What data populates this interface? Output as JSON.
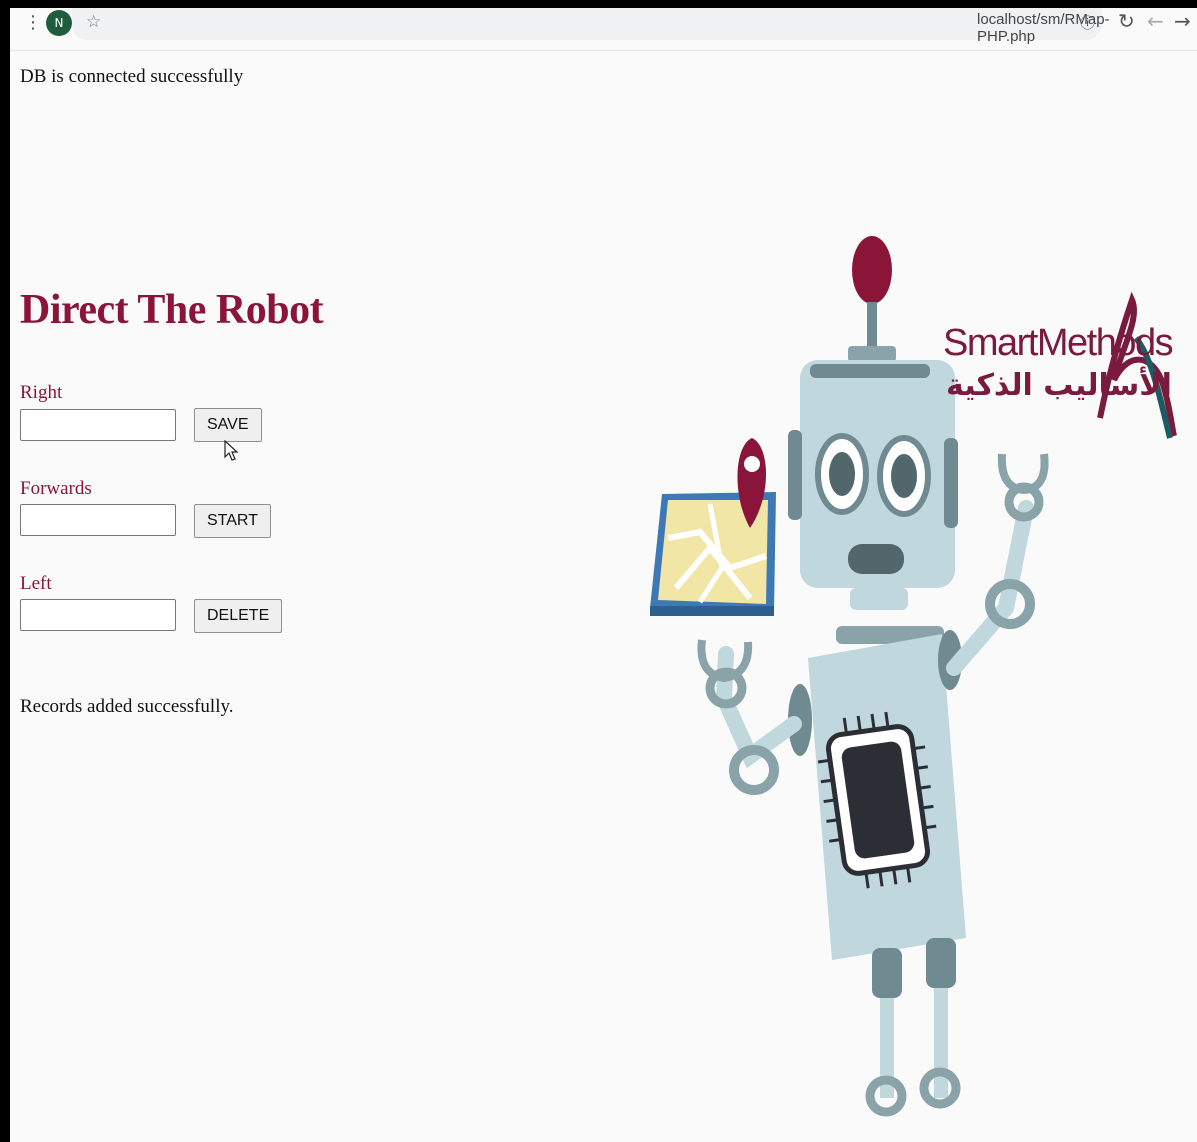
{
  "browser": {
    "url": "localhost/sm/RMap-PHP.php",
    "profile_initial": "N",
    "icons": [
      "menu-dots-icon",
      "star-icon",
      "info-icon",
      "reload-icon",
      "back-icon",
      "forward-icon"
    ]
  },
  "status": {
    "db": "DB is connected successfully",
    "records": "Records added successfully."
  },
  "page": {
    "title": "Direct The Robot"
  },
  "form": {
    "right_label": "Right",
    "right_value": "",
    "forwards_label": "Forwards",
    "forwards_value": "",
    "left_label": "Left",
    "left_value": "",
    "save_label": "SAVE",
    "start_label": "START",
    "delete_label": "DELETE"
  },
  "logo": {
    "english": "SmartMethods",
    "arabic": "الأساليب الذكية"
  },
  "colors": {
    "title": "#8a1538",
    "logo": "#7a1a3c",
    "robot_body": "#bfd7dd",
    "robot_dark": "#6f8a90",
    "accent_red": "#8a1538"
  }
}
